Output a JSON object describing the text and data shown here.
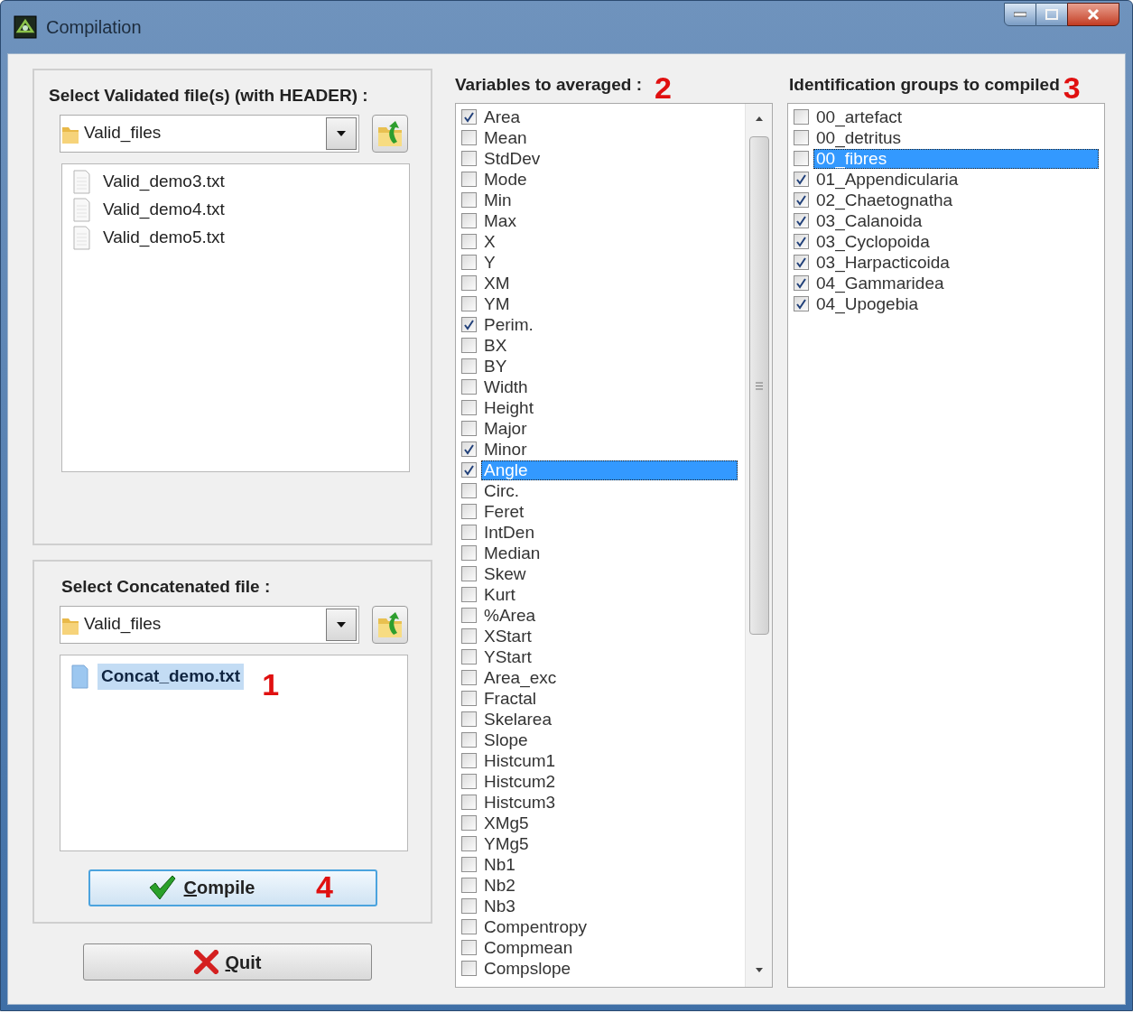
{
  "window": {
    "title": "Compilation"
  },
  "validated_files": {
    "label": "Select Validated file(s) (with HEADER) :",
    "folder": "Valid_files",
    "files": [
      {
        "name": "Valid_demo3.txt",
        "selected": false
      },
      {
        "name": "Valid_demo4.txt",
        "selected": false
      },
      {
        "name": "Valid_demo5.txt",
        "selected": false
      }
    ]
  },
  "concatenated_file": {
    "label": "Select Concatenated file :",
    "folder": "Valid_files",
    "marker": "1",
    "files": [
      {
        "name": "Concat_demo.txt",
        "selected": true
      }
    ]
  },
  "variables": {
    "label": "Variables to averaged :",
    "marker": "2",
    "items": [
      {
        "label": "Area",
        "checked": true,
        "selected": false
      },
      {
        "label": "Mean",
        "checked": false,
        "selected": false
      },
      {
        "label": "StdDev",
        "checked": false,
        "selected": false
      },
      {
        "label": "Mode",
        "checked": false,
        "selected": false
      },
      {
        "label": "Min",
        "checked": false,
        "selected": false
      },
      {
        "label": "Max",
        "checked": false,
        "selected": false
      },
      {
        "label": "X",
        "checked": false,
        "selected": false
      },
      {
        "label": "Y",
        "checked": false,
        "selected": false
      },
      {
        "label": "XM",
        "checked": false,
        "selected": false
      },
      {
        "label": "YM",
        "checked": false,
        "selected": false
      },
      {
        "label": "Perim.",
        "checked": true,
        "selected": false
      },
      {
        "label": "BX",
        "checked": false,
        "selected": false
      },
      {
        "label": "BY",
        "checked": false,
        "selected": false
      },
      {
        "label": "Width",
        "checked": false,
        "selected": false
      },
      {
        "label": "Height",
        "checked": false,
        "selected": false
      },
      {
        "label": "Major",
        "checked": false,
        "selected": false
      },
      {
        "label": "Minor",
        "checked": true,
        "selected": false
      },
      {
        "label": "Angle",
        "checked": true,
        "selected": true
      },
      {
        "label": "Circ.",
        "checked": false,
        "selected": false
      },
      {
        "label": "Feret",
        "checked": false,
        "selected": false
      },
      {
        "label": "IntDen",
        "checked": false,
        "selected": false
      },
      {
        "label": "Median",
        "checked": false,
        "selected": false
      },
      {
        "label": "Skew",
        "checked": false,
        "selected": false
      },
      {
        "label": "Kurt",
        "checked": false,
        "selected": false
      },
      {
        "label": "%Area",
        "checked": false,
        "selected": false
      },
      {
        "label": "XStart",
        "checked": false,
        "selected": false
      },
      {
        "label": "YStart",
        "checked": false,
        "selected": false
      },
      {
        "label": "Area_exc",
        "checked": false,
        "selected": false
      },
      {
        "label": "Fractal",
        "checked": false,
        "selected": false
      },
      {
        "label": "Skelarea",
        "checked": false,
        "selected": false
      },
      {
        "label": "Slope",
        "checked": false,
        "selected": false
      },
      {
        "label": "Histcum1",
        "checked": false,
        "selected": false
      },
      {
        "label": "Histcum2",
        "checked": false,
        "selected": false
      },
      {
        "label": "Histcum3",
        "checked": false,
        "selected": false
      },
      {
        "label": "XMg5",
        "checked": false,
        "selected": false
      },
      {
        "label": "YMg5",
        "checked": false,
        "selected": false
      },
      {
        "label": "Nb1",
        "checked": false,
        "selected": false
      },
      {
        "label": "Nb2",
        "checked": false,
        "selected": false
      },
      {
        "label": "Nb3",
        "checked": false,
        "selected": false
      },
      {
        "label": "Compentropy",
        "checked": false,
        "selected": false
      },
      {
        "label": "Compmean",
        "checked": false,
        "selected": false
      },
      {
        "label": "Compslope",
        "checked": false,
        "selected": false
      }
    ]
  },
  "groups": {
    "label": "Identification groups to compiled",
    "marker": "3",
    "items": [
      {
        "label": "00_artefact",
        "checked": false,
        "selected": false
      },
      {
        "label": "00_detritus",
        "checked": false,
        "selected": false
      },
      {
        "label": "00_fibres",
        "checked": false,
        "selected": true
      },
      {
        "label": "01_Appendicularia",
        "checked": true,
        "selected": false
      },
      {
        "label": "02_Chaetognatha",
        "checked": true,
        "selected": false
      },
      {
        "label": "03_Calanoida",
        "checked": true,
        "selected": false
      },
      {
        "label": "03_Cyclopoida",
        "checked": true,
        "selected": false
      },
      {
        "label": "03_Harpacticoida",
        "checked": true,
        "selected": false
      },
      {
        "label": "04_Gammaridea",
        "checked": true,
        "selected": false
      },
      {
        "label": "04_Upogebia",
        "checked": true,
        "selected": false
      }
    ]
  },
  "buttons": [
    {
      "label": "Compile",
      "kind": "compile",
      "marker": "4"
    },
    {
      "label": "Quit",
      "kind": "quit"
    }
  ]
}
